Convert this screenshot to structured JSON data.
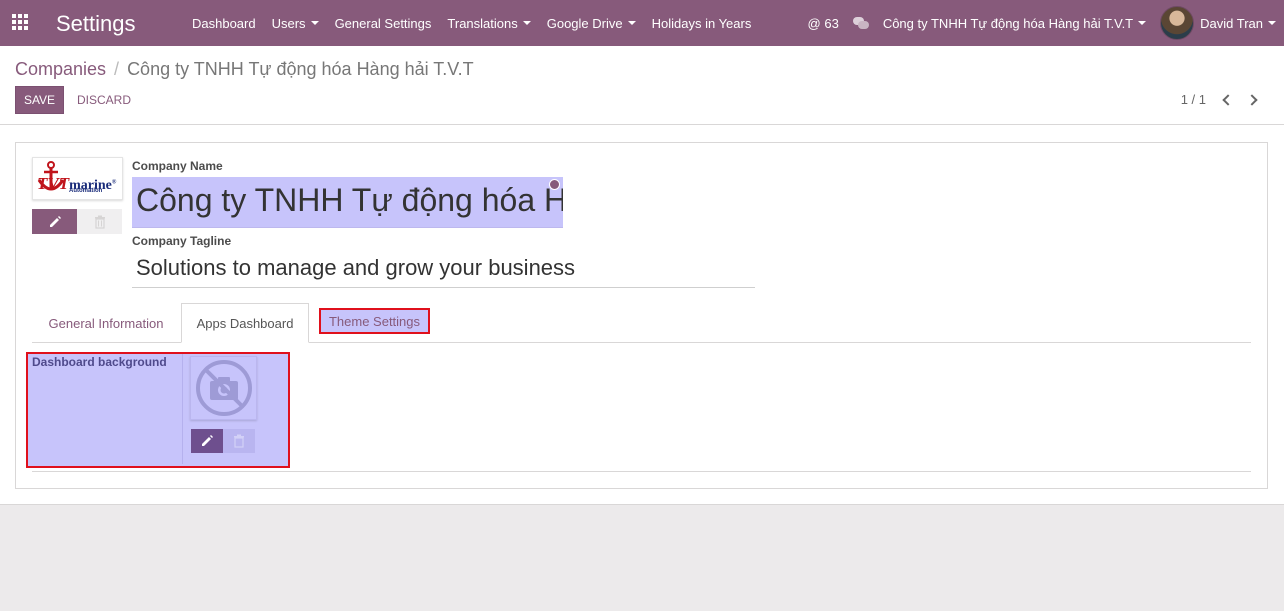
{
  "navbar": {
    "title": "Settings",
    "menu": [
      {
        "label": "Dashboard",
        "dropdown": false
      },
      {
        "label": "Users",
        "dropdown": true
      },
      {
        "label": "General Settings",
        "dropdown": false
      },
      {
        "label": "Translations",
        "dropdown": true
      },
      {
        "label": "Google Drive",
        "dropdown": true
      },
      {
        "label": "Holidays in Years",
        "dropdown": false
      }
    ],
    "mentions": "@ 63",
    "company_switcher": "Công ty TNHH Tự động hóa Hàng hải T.V.T",
    "user_name": "David Tran"
  },
  "control": {
    "breadcrumb_parent": "Companies",
    "breadcrumb_separator": "/",
    "breadcrumb_current": "Công ty TNHH Tự động hóa Hàng hải T.V.T",
    "save_label": "SAVE",
    "discard_label": "DISCARD",
    "pager": "1 / 1"
  },
  "form": {
    "logo": {
      "tv": "TVT",
      "marine": "marine",
      "reg": "®",
      "sub": "Automation"
    },
    "company_name_label": "Company Name",
    "company_name_value": "Công ty TNHH Tự động hóa Hàng hải T.V.T",
    "tagline_label": "Company Tagline",
    "tagline_value": "Solutions to manage and grow your business",
    "tabs": [
      "General Information",
      "Apps Dashboard",
      "Theme Settings"
    ],
    "active_tab": "Apps Dashboard",
    "dashboard_background_label": "Dashboard background"
  },
  "colors": {
    "brand": "#875a7b",
    "highlight": "#c7c4fb",
    "annotation_border": "#e0101c"
  }
}
